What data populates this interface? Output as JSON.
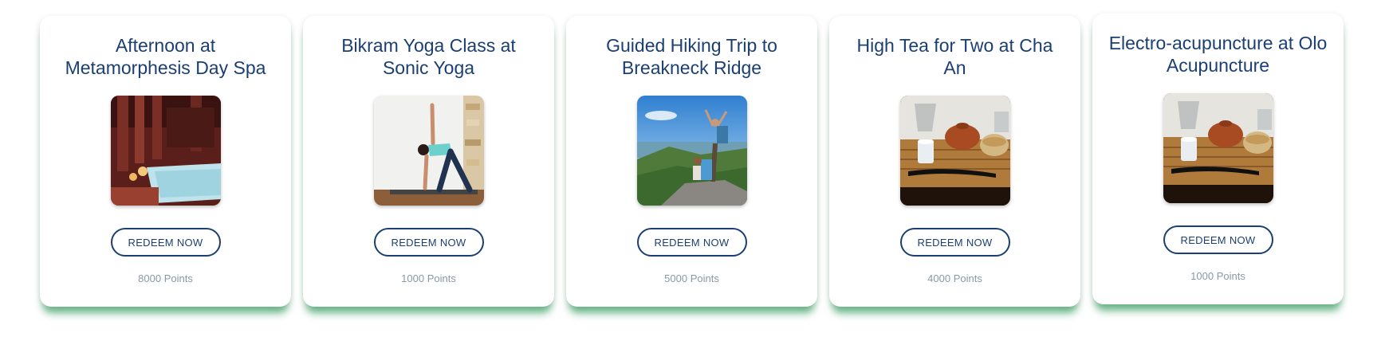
{
  "cards": [
    {
      "title": "Afternoon at Metamorphesis Day Spa",
      "button_label": "REDEEM NOW",
      "points": "8000 Points",
      "image": "spa-pool-photo"
    },
    {
      "title": "Bikram Yoga Class at Sonic Yoga",
      "button_label": "REDEEM NOW",
      "points": "1000 Points",
      "image": "yoga-pose-photo"
    },
    {
      "title": "Guided Hiking Trip to Breakneck Ridge",
      "button_label": "REDEEM NOW",
      "points": "5000 Points",
      "image": "hikers-summit-photo"
    },
    {
      "title": "High Tea for Two at Cha An",
      "button_label": "REDEEM NOW",
      "points": "4000 Points",
      "image": "tea-set-photo"
    },
    {
      "title": "Electro-acupuncture at Olo Acupuncture",
      "button_label": "REDEEM NOW",
      "points": "1000 Points",
      "image": "tea-set-photo"
    }
  ],
  "colors": {
    "title": "#1b3f73",
    "button_border": "#1b3f73",
    "points": "#8899aa",
    "card_shadow": "#3ca064"
  }
}
